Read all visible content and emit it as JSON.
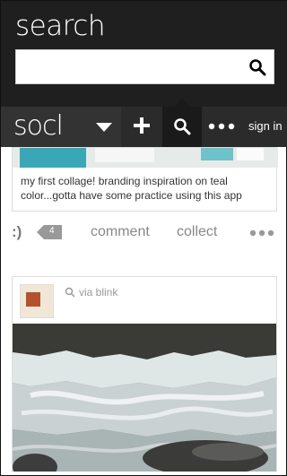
{
  "search": {
    "title": "search",
    "value": "",
    "placeholder": ""
  },
  "nav": {
    "logo": "socl",
    "sign_in": "sign in"
  },
  "post1": {
    "caption": "my first collage! branding inspiration on teal color...gotta have some practice using this app"
  },
  "actions": {
    "smiley": ":)",
    "count": "4",
    "comment": "comment",
    "collect": "collect"
  },
  "post2": {
    "via": "via blink"
  },
  "colors": {
    "header_bg": "#1f1f1f",
    "navbar_bg": "#2b2b2b",
    "accent_teal": "#3aa7b7"
  }
}
